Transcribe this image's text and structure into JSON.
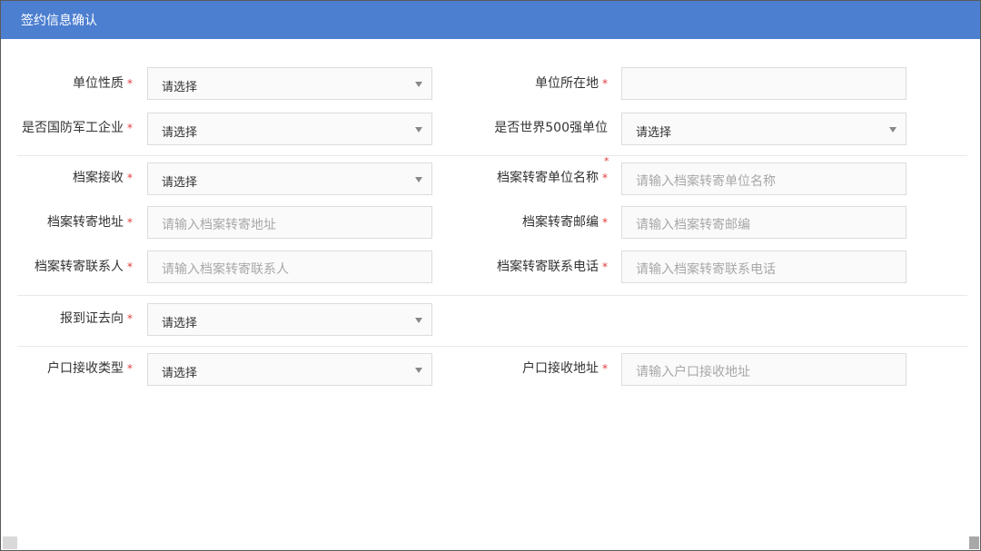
{
  "header": {
    "title": "签约信息确认"
  },
  "required_mark": "*",
  "select_placeholder": "请选择",
  "fields": {
    "unit_nature": {
      "label": "单位性质"
    },
    "unit_location": {
      "label": "单位所在地"
    },
    "defense_enterprise": {
      "label": "是否国防军工企业"
    },
    "fortune500": {
      "label": "是否世界500强单位"
    },
    "archive_receive": {
      "label": "档案接收"
    },
    "archive_unit_name": {
      "label": "档案转寄单位名称",
      "placeholder": "请输入档案转寄单位名称"
    },
    "archive_address": {
      "label": "档案转寄地址",
      "placeholder": "请输入档案转寄地址"
    },
    "archive_postcode": {
      "label": "档案转寄邮编",
      "placeholder": "请输入档案转寄邮编"
    },
    "archive_contact": {
      "label": "档案转寄联系人",
      "placeholder": "请输入档案转寄联系人"
    },
    "archive_phone": {
      "label": "档案转寄联系电话",
      "placeholder": "请输入档案转寄联系电话"
    },
    "report_destination": {
      "label": "报到证去向"
    },
    "hukou_type": {
      "label": "户口接收类型"
    },
    "hukou_address": {
      "label": "户口接收地址",
      "placeholder": "请输入户口接收地址"
    }
  },
  "colors": {
    "header_bg": "#4d7fd0",
    "required": "#e23b3b"
  }
}
